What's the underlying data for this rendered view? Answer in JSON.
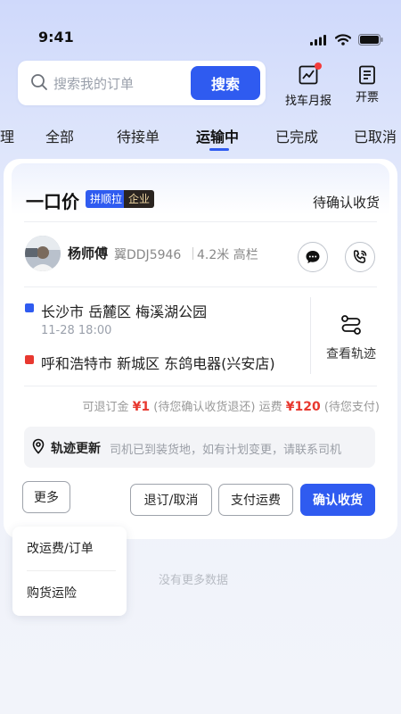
{
  "status_bar": {
    "time": "9:41"
  },
  "search": {
    "placeholder": "搜索我的订单",
    "button_label": "搜索"
  },
  "top_actions": {
    "monthly_report": "找车月报",
    "invoice": "开票"
  },
  "tabs": [
    {
      "label": "理"
    },
    {
      "label": "全部"
    },
    {
      "label": "待接单"
    },
    {
      "label": "运输中",
      "active": true
    },
    {
      "label": "已完成"
    },
    {
      "label": "已取消"
    }
  ],
  "order": {
    "price_type": "一口价",
    "badge_pin": "拼顺拉",
    "badge_biz": "企业",
    "status": "待确认收货",
    "driver": {
      "name": "杨师傅",
      "plate": "翼DDJ5946",
      "truck_spec": "4.2米 高栏"
    },
    "route": {
      "origin": "长沙市 岳麓区 梅溪湖公园",
      "pickup_time": "11-28 18:00",
      "destination": "呼和浩特市 新城区 东鸽电器(兴安店)"
    },
    "track_label": "查看轨迹",
    "fees": {
      "refund_label": "可退订金",
      "refund_amount": "¥1",
      "refund_note": "(待您确认收货退还)",
      "freight_label": "运费",
      "freight_amount": "¥120",
      "freight_note": "(待您支付)"
    },
    "tip": {
      "title": "轨迹更新",
      "text": "司机已到装货地，如有计划变更，请联系司机"
    },
    "actions": {
      "more": "更多",
      "cancel": "退订/取消",
      "pay": "支付运费",
      "confirm": "确认收货"
    }
  },
  "more_menu": {
    "items": [
      "改运费/订单",
      "购货运险"
    ]
  },
  "footer": {
    "no_more": "没有更多数据"
  },
  "colors": {
    "primary": "#2f5bf0",
    "origin_dot": "#2f5bf0",
    "destination_dot": "#e8382f",
    "price_red": "#e8382f"
  }
}
